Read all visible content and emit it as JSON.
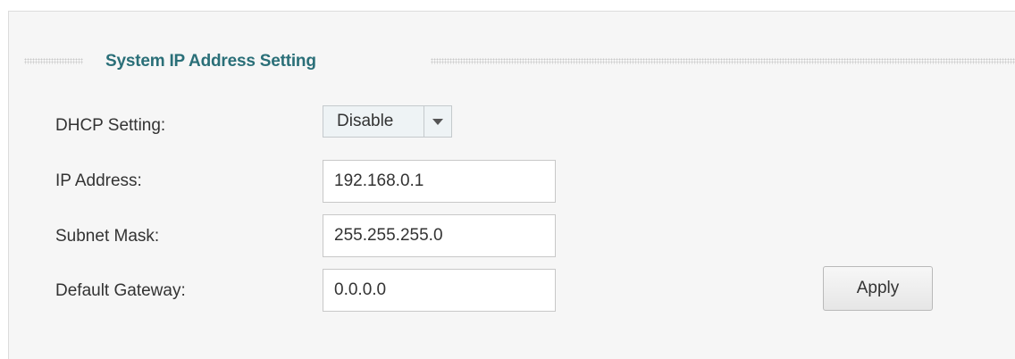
{
  "section": {
    "title": "System IP Address Setting"
  },
  "form": {
    "dhcp": {
      "label": "DHCP Setting:",
      "selected": "Disable"
    },
    "ip_address": {
      "label": "IP Address:",
      "value": "192.168.0.1"
    },
    "subnet_mask": {
      "label": "Subnet Mask:",
      "value": "255.255.255.0"
    },
    "default_gateway": {
      "label": "Default Gateway:",
      "value": "0.0.0.0"
    }
  },
  "actions": {
    "apply_label": "Apply"
  },
  "colors": {
    "title": "#2a6f78",
    "panel_background": "#f6f6f6"
  },
  "icons": {
    "dropdown": "chevron-down-icon"
  }
}
